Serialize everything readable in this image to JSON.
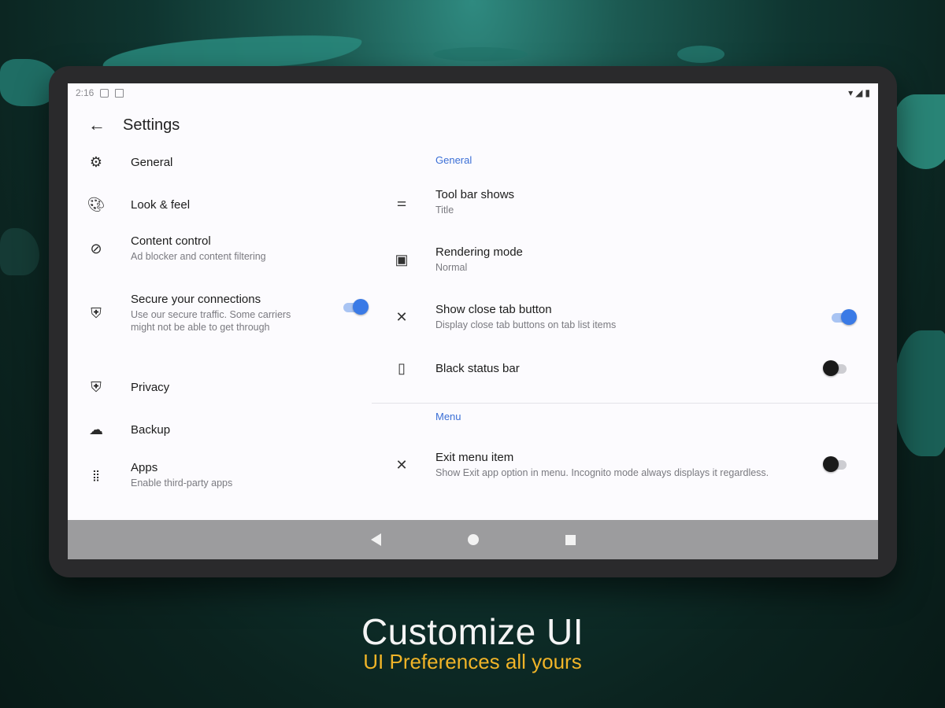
{
  "status_bar": {
    "time": "2:16"
  },
  "appbar": {
    "title": "Settings"
  },
  "nav_items": [
    {
      "icon": "gear-icon",
      "title": "General",
      "subtitle": ""
    },
    {
      "icon": "palette-icon",
      "title": "Look & feel",
      "subtitle": ""
    },
    {
      "icon": "block-icon",
      "title": "Content control",
      "subtitle": "Ad blocker and content filtering"
    },
    {
      "icon": "shield-icon",
      "title": "Secure your connections",
      "subtitle": "Use our secure traffic. Some carriers might not be able to get through",
      "toggle": true
    },
    {
      "icon": "shield-icon",
      "title": "Privacy",
      "subtitle": ""
    },
    {
      "icon": "cloud-upload-icon",
      "title": "Backup",
      "subtitle": ""
    },
    {
      "icon": "apps-grid-icon",
      "title": "Apps",
      "subtitle": "Enable third-party apps"
    }
  ],
  "general_section": {
    "header": "General",
    "prefs": [
      {
        "icon": "short-text-icon",
        "title": "Tool bar shows",
        "subtitle": "Title"
      },
      {
        "icon": "rendering-icon",
        "title": "Rendering mode",
        "subtitle": "Normal"
      },
      {
        "icon": "close-icon",
        "title": "Show close tab button",
        "subtitle": "Display close tab buttons on tab list items",
        "toggle": true
      },
      {
        "icon": "phone-icon",
        "title": "Black status bar",
        "subtitle": "",
        "toggle": false
      }
    ]
  },
  "menu_section": {
    "header": "Menu",
    "prefs": [
      {
        "icon": "close-icon",
        "title": "Exit menu item",
        "subtitle": "Show Exit app option in menu. Incognito mode always displays it regardless.",
        "toggle": false
      }
    ]
  },
  "caption": {
    "title": "Customize UI",
    "subtitle": "UI Preferences all yours"
  },
  "colors": {
    "accent": "#3a7ae6",
    "section_header": "#3b6fd6",
    "caption_subtitle": "#f0b428"
  }
}
